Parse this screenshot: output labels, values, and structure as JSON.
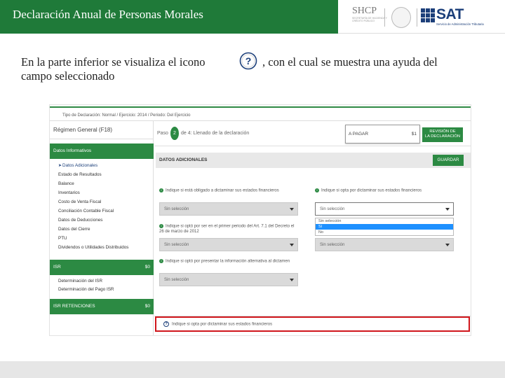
{
  "header": {
    "title": "Declaración Anual de Personas Morales",
    "shcp_logo_text": "SHCP",
    "shcp_logo_sub": "SECRETARÍA DE HACIENDA Y CRÉDITO PÚBLICO",
    "sat_logo_text": "SAT",
    "sat_logo_sub": "Servicio de Administración Tributaria",
    "accent_color": "#1f7a39"
  },
  "intro": {
    "line1a": "En la parte inferior se visualiza el icono",
    "line1b": ", con el cual se muestra una ayuda del",
    "line2": "campo seleccionado",
    "help_icon_glyph": "?"
  },
  "screenshot": {
    "breadcrumb": "Tipo de Declaración: Normal / Ejercicio: 2014 / Periodo: Del Ejercicio",
    "regime": "Régimen General (F18)",
    "sidebar": {
      "sections": [
        {
          "title": "Datos Informativos",
          "amount": ""
        },
        {
          "title": "ISR",
          "amount": "$0"
        },
        {
          "title": "ISR RETENCIONES",
          "amount": "$0"
        }
      ],
      "datos_items": [
        "Datos Adicionales",
        "Estado de Resultados",
        "Balance",
        "Inventarios",
        "Costo de Venta Fiscal",
        "Conciliación Contable Fiscal",
        "Datos de Deducciones",
        "Datos del Cierre",
        "PTU",
        "Dividendos o Utilidades Distribuidos"
      ],
      "isr_items": [
        "Determinación del ISR",
        "Determinación del Pago ISR"
      ]
    },
    "paso": {
      "prefix": "Paso",
      "step": "2",
      "rest": "de 4: Llenado de la declaración"
    },
    "pagar": {
      "label": "A PAGAR",
      "value": "$1"
    },
    "revision_button": {
      "line1": "REVISIÓN DE",
      "line2": "LA DECLARACIÓN"
    },
    "datos_adicionales_title": "DATOS ADICIONALES",
    "guardar_button": "GUARDAR",
    "questions": [
      "Indique si está obligado a dictaminar sus estados financieros",
      "Indique si opta por dictaminar sus estados financieros",
      "Indique si optó por ser en el primer periodo del Art. 7.1 del Decreto el 26 de marzo de 2012",
      "Indique si optó por presentar la información alternativa al dictamen"
    ],
    "select_default": "Sin selección",
    "dropdown_options": [
      "Sin selección",
      "Sí",
      "No"
    ],
    "dropdown_highlighted": "Sí",
    "help_text": "Indique si opta por dictaminar sus estados financieros",
    "help_border_color": "#d0161c"
  }
}
